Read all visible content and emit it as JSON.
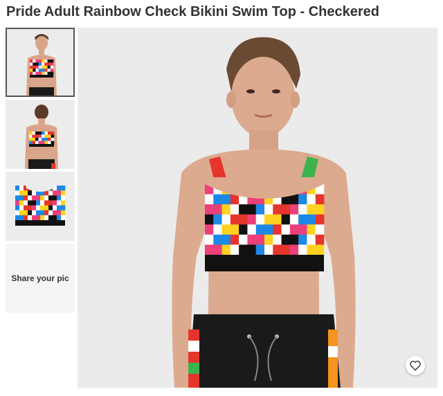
{
  "product": {
    "title": "Pride Adult Rainbow Check Bikini Swim Top - Checkered"
  },
  "gallery": {
    "thumbnails": [
      {
        "view": "front",
        "selected": true
      },
      {
        "view": "back",
        "selected": false
      },
      {
        "view": "flat",
        "selected": false
      }
    ],
    "share_label": "Share your pic"
  },
  "favorite": {
    "icon": "heart-icon"
  },
  "colors": {
    "checks": [
      "#e5352c",
      "#f7941d",
      "#ffd21f",
      "#3cb44b",
      "#1e88e5",
      "#7b3fa0",
      "#ec407a",
      "#26c6da",
      "#111111",
      "#ffffff"
    ]
  }
}
